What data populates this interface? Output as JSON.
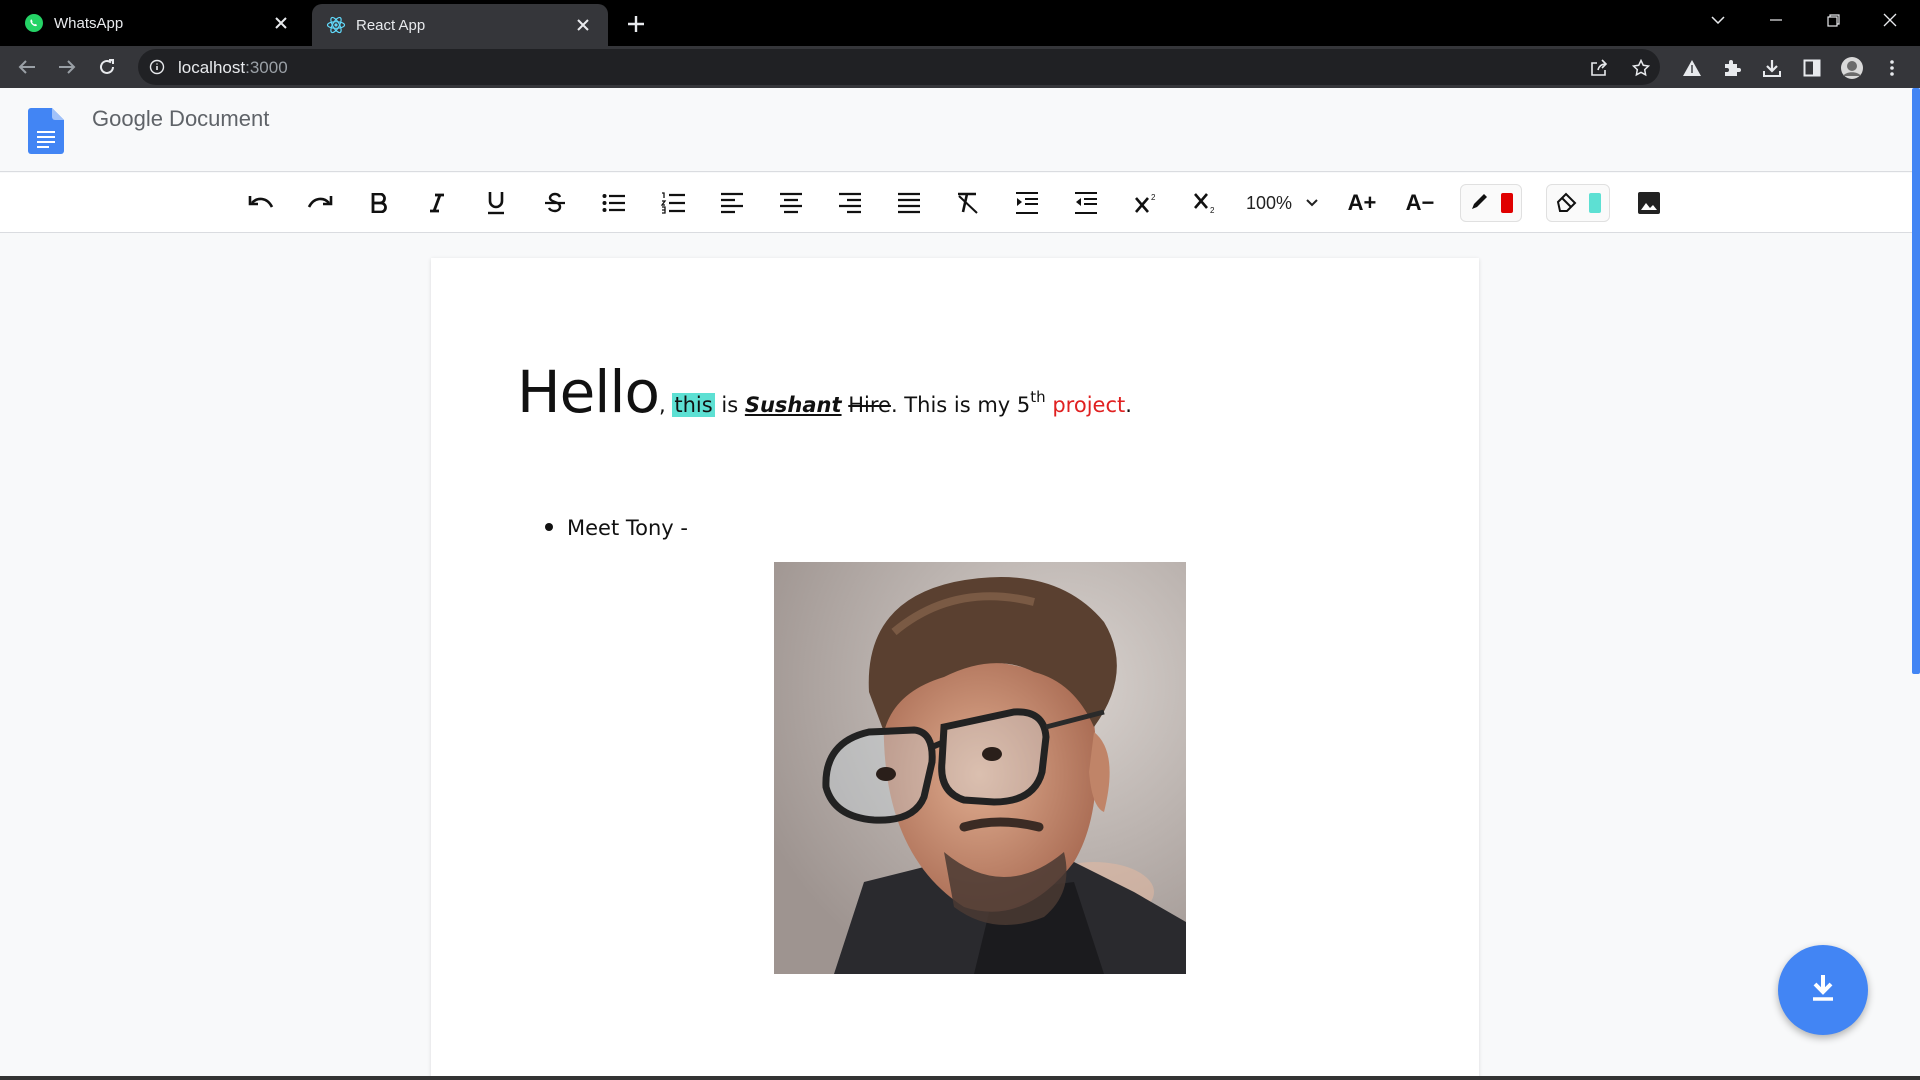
{
  "browser": {
    "tabs": [
      {
        "title": "WhatsApp",
        "icon": "whatsapp-icon"
      },
      {
        "title": "React App",
        "icon": "react-icon",
        "active": true
      }
    ],
    "url_host": "localhost",
    "url_port": ":3000"
  },
  "app": {
    "title": "Google Document"
  },
  "toolbar": {
    "buttons": [
      "undo-icon",
      "redo-icon",
      "bold-icon",
      "italic-icon",
      "underline-icon",
      "strikethrough-icon",
      "bulleted-list-icon",
      "numbered-list-icon",
      "align-left-icon",
      "align-center-icon",
      "align-right-icon",
      "justify-icon",
      "clear-formatting-icon",
      "indent-icon",
      "outdent-icon",
      "superscript-icon",
      "subscript-icon"
    ],
    "zoom": "100%",
    "font_increase": "A+",
    "font_decrease": "A−",
    "text_color": "#e00000",
    "highlight_color": "#5de0d3"
  },
  "document": {
    "word_hello": "Hello",
    "comma": ",",
    "word_this": "this",
    "word_is": " is ",
    "word_sushant": "Sushant",
    "word_hire": "Hire",
    "sentence_mid": ". This is my 5",
    "sup_th": "th",
    "word_project": "project",
    "period": ".",
    "bullet_text": "Meet Tony -"
  },
  "colors": {
    "accent": "#4285f4",
    "highlight": "#5de0d3",
    "red_text": "#e02020"
  }
}
